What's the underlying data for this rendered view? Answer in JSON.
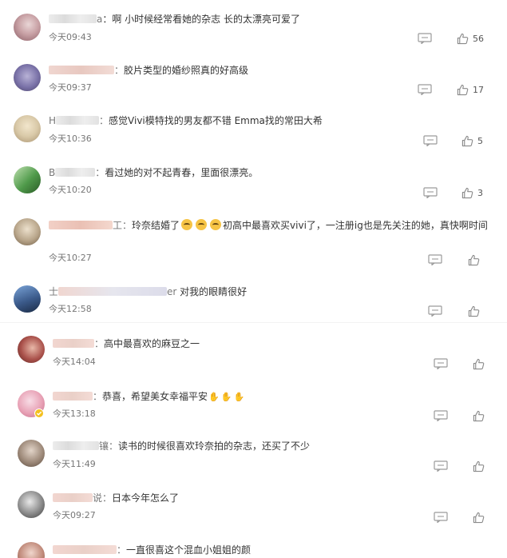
{
  "comments": [
    {
      "name_prefix": "",
      "name_suffix": "a",
      "text": "：啊 小时候经常看她的杂志 长的太漂亮可爱了",
      "time": "今天09:43",
      "likes": "56",
      "avatar_color": "#c9a2a6"
    },
    {
      "name_prefix": "",
      "name_suffix": "：",
      "text": "胶片类型的婚纱照真的好高级",
      "time": "今天09:37",
      "likes": "17",
      "avatar_color": "#7a72a8"
    },
    {
      "name_prefix": "H",
      "name_suffix": "：",
      "text": "感觉Vivi模特找的男友都不错 Emma找的常田大希",
      "time": "今天10:36",
      "likes": "5",
      "avatar_color": "#d9c9a8"
    },
    {
      "name_prefix": "B",
      "name_suffix": "：",
      "text": "看过她的对不起青春，里面很漂亮。",
      "time": "今天10:20",
      "likes": "3",
      "avatar_color": "#4f9a4a"
    },
    {
      "name_prefix": "",
      "name_suffix": "工：",
      "text_before": "玲奈结婚了",
      "text": "初高中最喜欢买vivi了，一注册ig也是先关注的她，真快啊时间",
      "time": "今天10:27",
      "likes": "",
      "avatar_color": "#b8a58a"
    },
    {
      "name_prefix": "士",
      "name_suffix": "er",
      "text": "对我的眼睛很好",
      "time": "今天12:58",
      "likes": "",
      "avatar_color": "#3b5a8a"
    },
    {
      "name_prefix": "",
      "name_suffix": "：",
      "text": "高中最喜欢的麻豆之一",
      "time": "今天14:04",
      "likes": "",
      "avatar_color": "#a9504a"
    },
    {
      "name_prefix": "",
      "name_suffix": "：",
      "text": "恭喜，希望美女幸福平安",
      "time": "今天13:18",
      "likes": "",
      "avatar_color": "#e8a2b6"
    },
    {
      "name_prefix": "",
      "name_suffix": "镶：",
      "text": "读书的时候很喜欢玲奈拍的杂志，还买了不少",
      "time": "今天11:49",
      "likes": "",
      "avatar_color": "#9e8a7a"
    },
    {
      "name_prefix": "",
      "name_suffix": "说：",
      "text": "日本今年怎么了",
      "time": "今天09:27",
      "likes": "",
      "avatar_color": "#8a8a8a"
    },
    {
      "name_prefix": "",
      "name_suffix": "：",
      "text": "一直很喜这个混血小姐姐的颜",
      "time": "",
      "likes": "",
      "avatar_color": "#c08a7a"
    }
  ]
}
